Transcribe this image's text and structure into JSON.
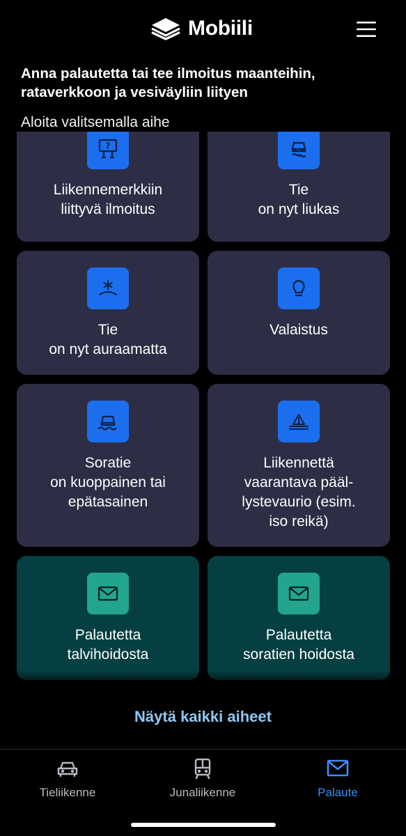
{
  "app": {
    "title": "Mobiili"
  },
  "intro": {
    "heading": "Anna palautetta tai tee ilmoitus maanteihin, rataverkkoon ja vesiväyliin liityen",
    "subheading": "Aloita valitsemalla aihe"
  },
  "cards": [
    {
      "label": "Liikennemerkkiin\nliittyvä ilmoitus",
      "icon": "road-sign-icon",
      "variant": "blue"
    },
    {
      "label": "Tie\non nyt liukas",
      "icon": "slippery-car-icon",
      "variant": "blue"
    },
    {
      "label": "Tie\non nyt auraamatta",
      "icon": "snow-road-icon",
      "variant": "blue"
    },
    {
      "label": "Valaistus",
      "icon": "lightbulb-icon",
      "variant": "blue"
    },
    {
      "label": "Soratie\non kuoppainen tai\nepätasainen",
      "icon": "bumpy-road-car-icon",
      "variant": "blue"
    },
    {
      "label": "Liikennettä\nvaarantava pääl-\nlystevaurio (esim.\niso reikä)",
      "icon": "road-hazard-icon",
      "variant": "blue"
    },
    {
      "label": "Palautetta\ntalvihoidosta",
      "icon": "mail-icon",
      "variant": "teal"
    },
    {
      "label": "Palautetta\nsoratien hoidosta",
      "icon": "mail-icon",
      "variant": "teal"
    }
  ],
  "show_all": {
    "label": "Näytä kaikki aiheet"
  },
  "tabs": [
    {
      "label": "Tieliikenne",
      "icon": "car-icon",
      "active": false
    },
    {
      "label": "Junaliikenne",
      "icon": "train-icon",
      "active": false
    },
    {
      "label": "Palaute",
      "icon": "mail-icon",
      "active": true
    }
  ],
  "colors": {
    "background": "#000000",
    "card": "#2d2d45",
    "card_teal": "#053f41",
    "icon_blue": "#1b6fee",
    "icon_teal": "#22a58c",
    "link": "#8fc8f4",
    "tab_active": "#3d8df4"
  }
}
